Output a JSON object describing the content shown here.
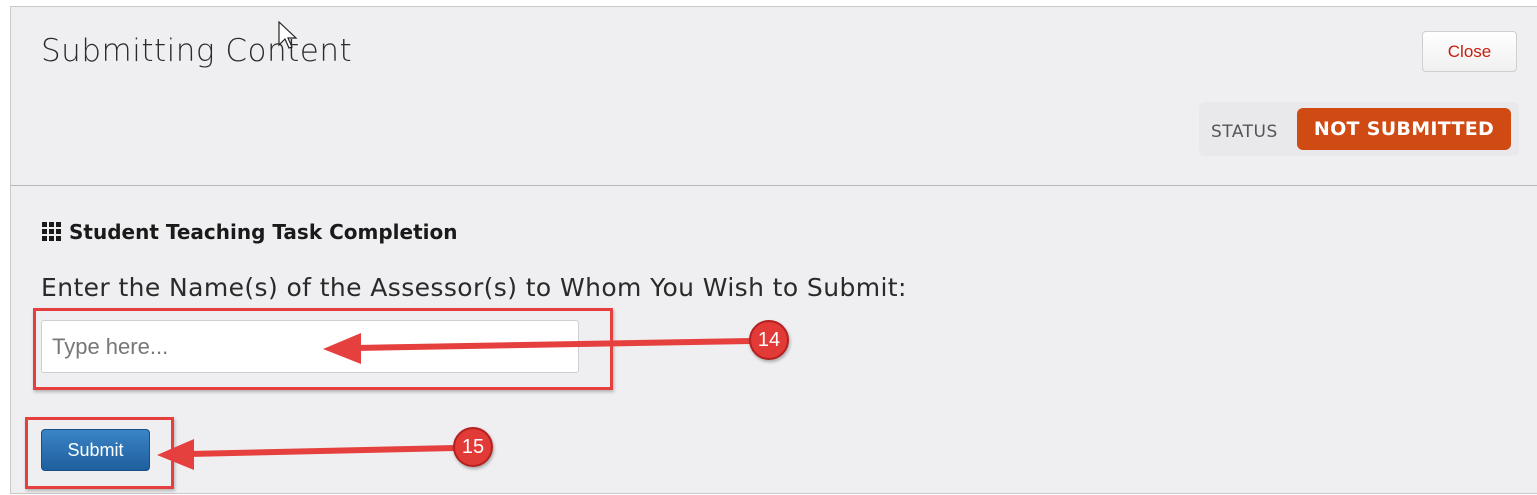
{
  "dialog": {
    "title": "Submitting Content",
    "close_label": "Close",
    "status_label": "STATUS",
    "status_value": "NOT SUBMITTED"
  },
  "section": {
    "icon": "grid-icon",
    "title": "Student Teaching Task Completion",
    "prompt": "Enter the Name(s) of the Assessor(s) to Whom You Wish to Submit:",
    "input_value": "",
    "input_placeholder": "Type here...",
    "submit_label": "Submit"
  },
  "annotations": [
    {
      "number": "14",
      "target": "assessor-input"
    },
    {
      "number": "15",
      "target": "submit-button"
    }
  ],
  "colors": {
    "status_badge": "#d04a14",
    "annotation_red": "#e5403e",
    "submit_blue": "#2a6fb0",
    "close_text": "#c81d10"
  }
}
